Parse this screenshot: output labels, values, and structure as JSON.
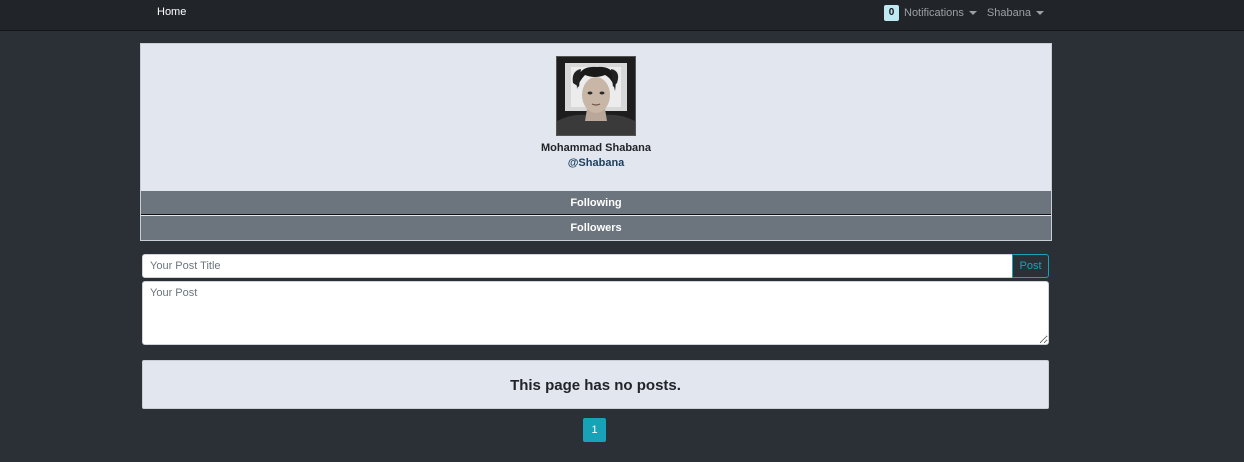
{
  "navbar": {
    "home_label": "Home",
    "notifications_count": "0",
    "notifications_label": "Notifications",
    "user_label": "Shabana"
  },
  "profile": {
    "name": "Mohammad Shabana",
    "handle": "@Shabana",
    "following_label": "Following",
    "followers_label": "Followers"
  },
  "post_form": {
    "title_placeholder": "Your Post Title",
    "post_button_label": "Post",
    "body_placeholder": "Your Post"
  },
  "posts": {
    "empty_message": "This page has no posts."
  },
  "pagination": {
    "pages": [
      "1"
    ],
    "current": "1"
  },
  "colors": {
    "accent": "#17a2b8",
    "navbar_bg": "#212529",
    "page_bg": "#2a3036",
    "card_bg": "#e2e6ee",
    "bar_bg": "#6c757d"
  }
}
